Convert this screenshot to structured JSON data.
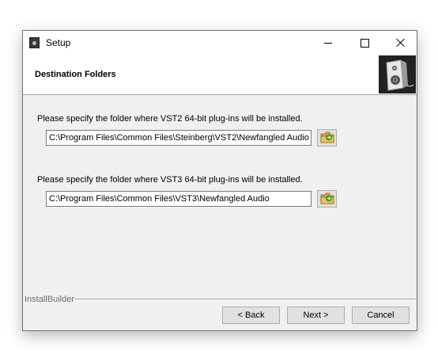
{
  "window": {
    "title": "Setup",
    "app_icon": "speaker-app-icon",
    "controls": {
      "minimize": "minimize-icon",
      "maximize": "maximize-icon",
      "close": "close-icon"
    }
  },
  "header": {
    "title": "Destination Folders",
    "logo_icon": "speaker-logo-icon"
  },
  "vst2": {
    "label": "Please specify the folder where VST2 64-bit plug-ins will be installed.",
    "path": "C:\\Program Files\\Common Files\\Steinberg\\VST2\\Newfangled Audio",
    "browse_icon": "folder-browse-icon"
  },
  "vst3": {
    "label": "Please specify the folder where VST3 64-bit plug-ins will be installed.",
    "path": "C:\\Program Files\\Common Files\\VST3\\Newfangled Audio",
    "browse_icon": "folder-browse-icon"
  },
  "footer": {
    "brand": "InstallBuilder",
    "back_label": "< Back",
    "next_label": "Next >",
    "cancel_label": "Cancel"
  },
  "colors": {
    "window_bg": "#f0f0f0",
    "header_bg": "#ffffff",
    "button_bg": "#e1e1e1",
    "button_border": "#adadad",
    "logo_bg": "#222222"
  }
}
